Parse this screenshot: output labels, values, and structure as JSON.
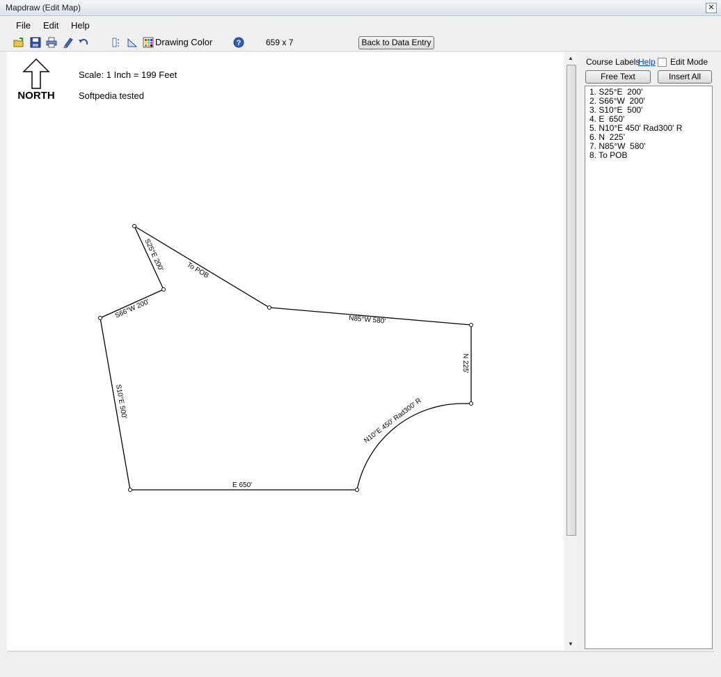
{
  "window": {
    "title": "Mapdraw (Edit Map)",
    "close_glyph": "✕"
  },
  "menu": {
    "file": "File",
    "edit": "Edit",
    "help": "Help"
  },
  "toolbar": {
    "drawing_color": "Drawing Color",
    "dimensions": "659 x 7",
    "back_button": "Back to Data Entry"
  },
  "map": {
    "north_label": "NORTH",
    "scale": "Scale: 1 Inch = 199 Feet",
    "note": "Softpedia tested",
    "course_labels": {
      "c1": "S25°E  200'",
      "c2": "S66°W  200'",
      "c3": "S10°E  500'",
      "c4": "E  650'",
      "c5": "N10°E 450' Rad300' R",
      "c6": "N  225'",
      "c7": "N85°W  580'",
      "c8": "To POB"
    }
  },
  "panel": {
    "course_labels": "Course Labels",
    "help_link": "Help",
    "edit_mode": "Edit Mode",
    "free_text_button": "Free Text",
    "insert_all_button": "Insert All",
    "courses": [
      "1. S25°E  200'",
      "2. S66°W  200'",
      "3. S10°E  500'",
      "4. E  650'",
      "5. N10°E 450' Rad300' R",
      "6. N  225'",
      "7. N85°W  580'",
      "8. To POB"
    ]
  },
  "icons": [
    "open-icon",
    "save-icon",
    "print-icon",
    "pencil-icon",
    "undo-icon",
    "align-icon",
    "triangle-icon",
    "color-grid-icon",
    "help-icon"
  ]
}
